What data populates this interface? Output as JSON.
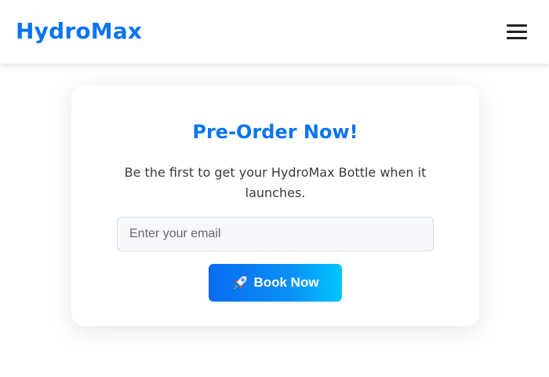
{
  "header": {
    "brand": "HydroMax",
    "menu_icon": "hamburger-menu-icon"
  },
  "card": {
    "title": "Pre-Order Now!",
    "subtitle": "Be the first to get your HydroMax Bottle when it launches.",
    "email_placeholder": "Enter your email",
    "email_value": "",
    "button_icon": "rocket-icon",
    "button_label": "Book Now"
  },
  "colors": {
    "brand": "#0a74f0",
    "button_gradient_start": "#0a6cf2",
    "button_gradient_end": "#00c6ff",
    "text": "#3a3a3a"
  }
}
